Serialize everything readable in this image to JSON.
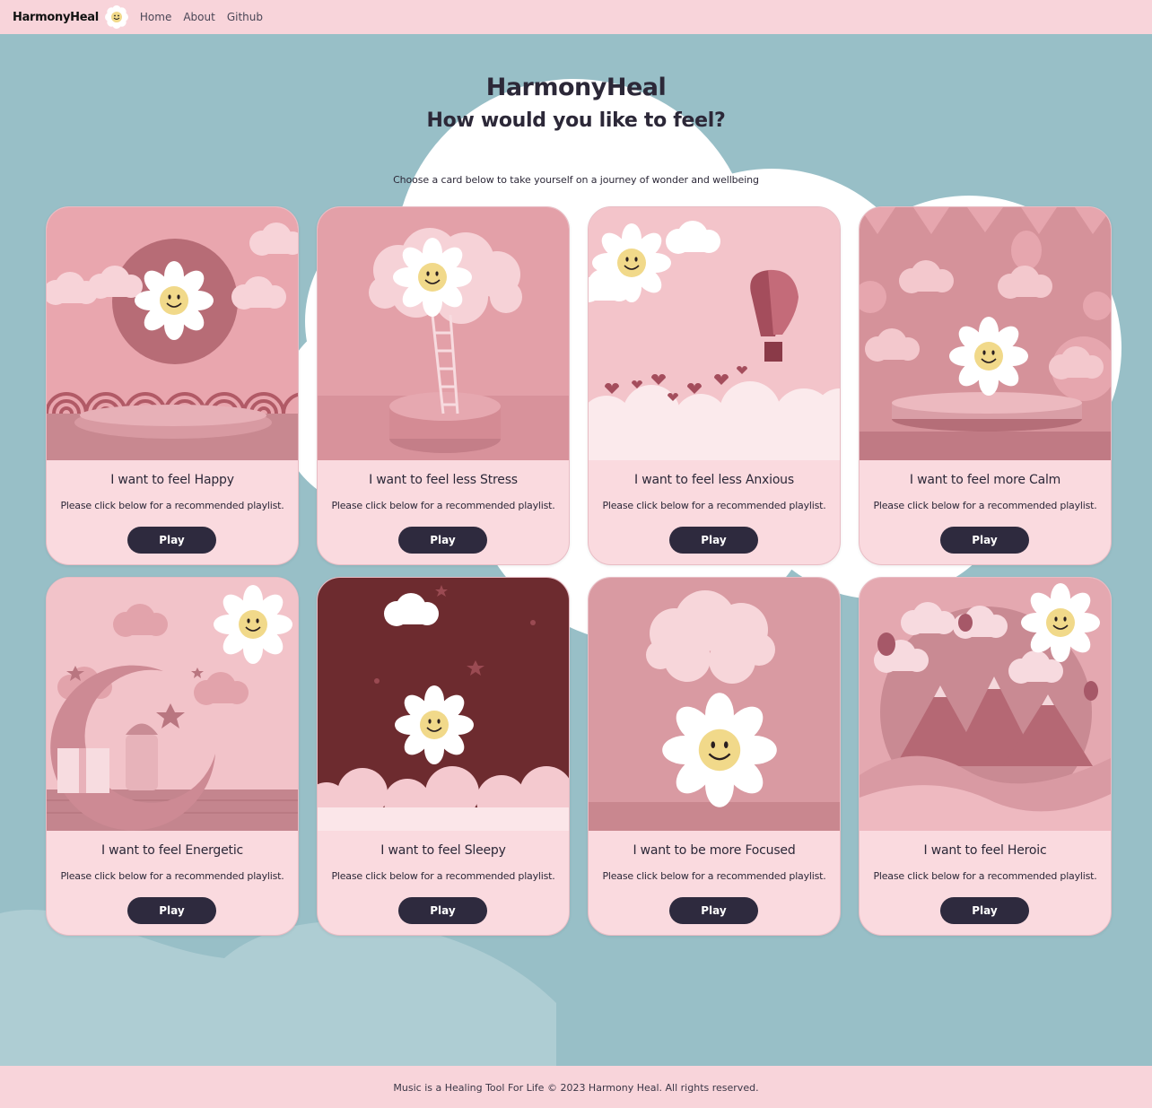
{
  "nav": {
    "brand": "HarmonyHeal",
    "logo_icon": "smiley-daisy-icon",
    "links": [
      "Home",
      "About",
      "Github"
    ]
  },
  "hero": {
    "title": "HarmonyHeal",
    "subtitle": "How would you like to feel?",
    "tagline": "Choose a card below to take yourself on a journey of wonder and wellbeing"
  },
  "cards": [
    {
      "title": "I want to feel Happy",
      "desc": "Please click below for a recommended playlist.",
      "button": "Play",
      "scene": "sun-clouds-waves"
    },
    {
      "title": "I want to feel less Stress",
      "desc": "Please click below for a recommended playlist.",
      "button": "Play",
      "scene": "cloud-ladder"
    },
    {
      "title": "I want to feel less Anxious",
      "desc": "Please click below for a recommended playlist.",
      "button": "Play",
      "scene": "hot-air-balloon-hearts"
    },
    {
      "title": "I want to feel more Calm",
      "desc": "Please click below for a recommended playlist.",
      "button": "Play",
      "scene": "party-stage-balloons"
    },
    {
      "title": "I want to feel Energetic",
      "desc": "Please click below for a recommended playlist.",
      "button": "Play",
      "scene": "moon-lantern-gift"
    },
    {
      "title": "I want to feel Sleepy",
      "desc": "Please click below for a recommended playlist.",
      "button": "Play",
      "scene": "night-sky-clouds"
    },
    {
      "title": "I want to be more Focused",
      "desc": "Please click below for a recommended playlist.",
      "button": "Play",
      "scene": "big-daisy-cloud"
    },
    {
      "title": "I want to feel Heroic",
      "desc": "Please click below for a recommended playlist.",
      "button": "Play",
      "scene": "paper-mountains-balloons"
    }
  ],
  "footer": {
    "text": "Music is a Healing Tool For Life © 2023 Harmony Heal. All rights reserved."
  },
  "colors": {
    "background": "#98bfc7",
    "nav": "#f8d4da",
    "card": "#fadadf",
    "button": "#2e2a3e",
    "text": "#2c2838"
  }
}
